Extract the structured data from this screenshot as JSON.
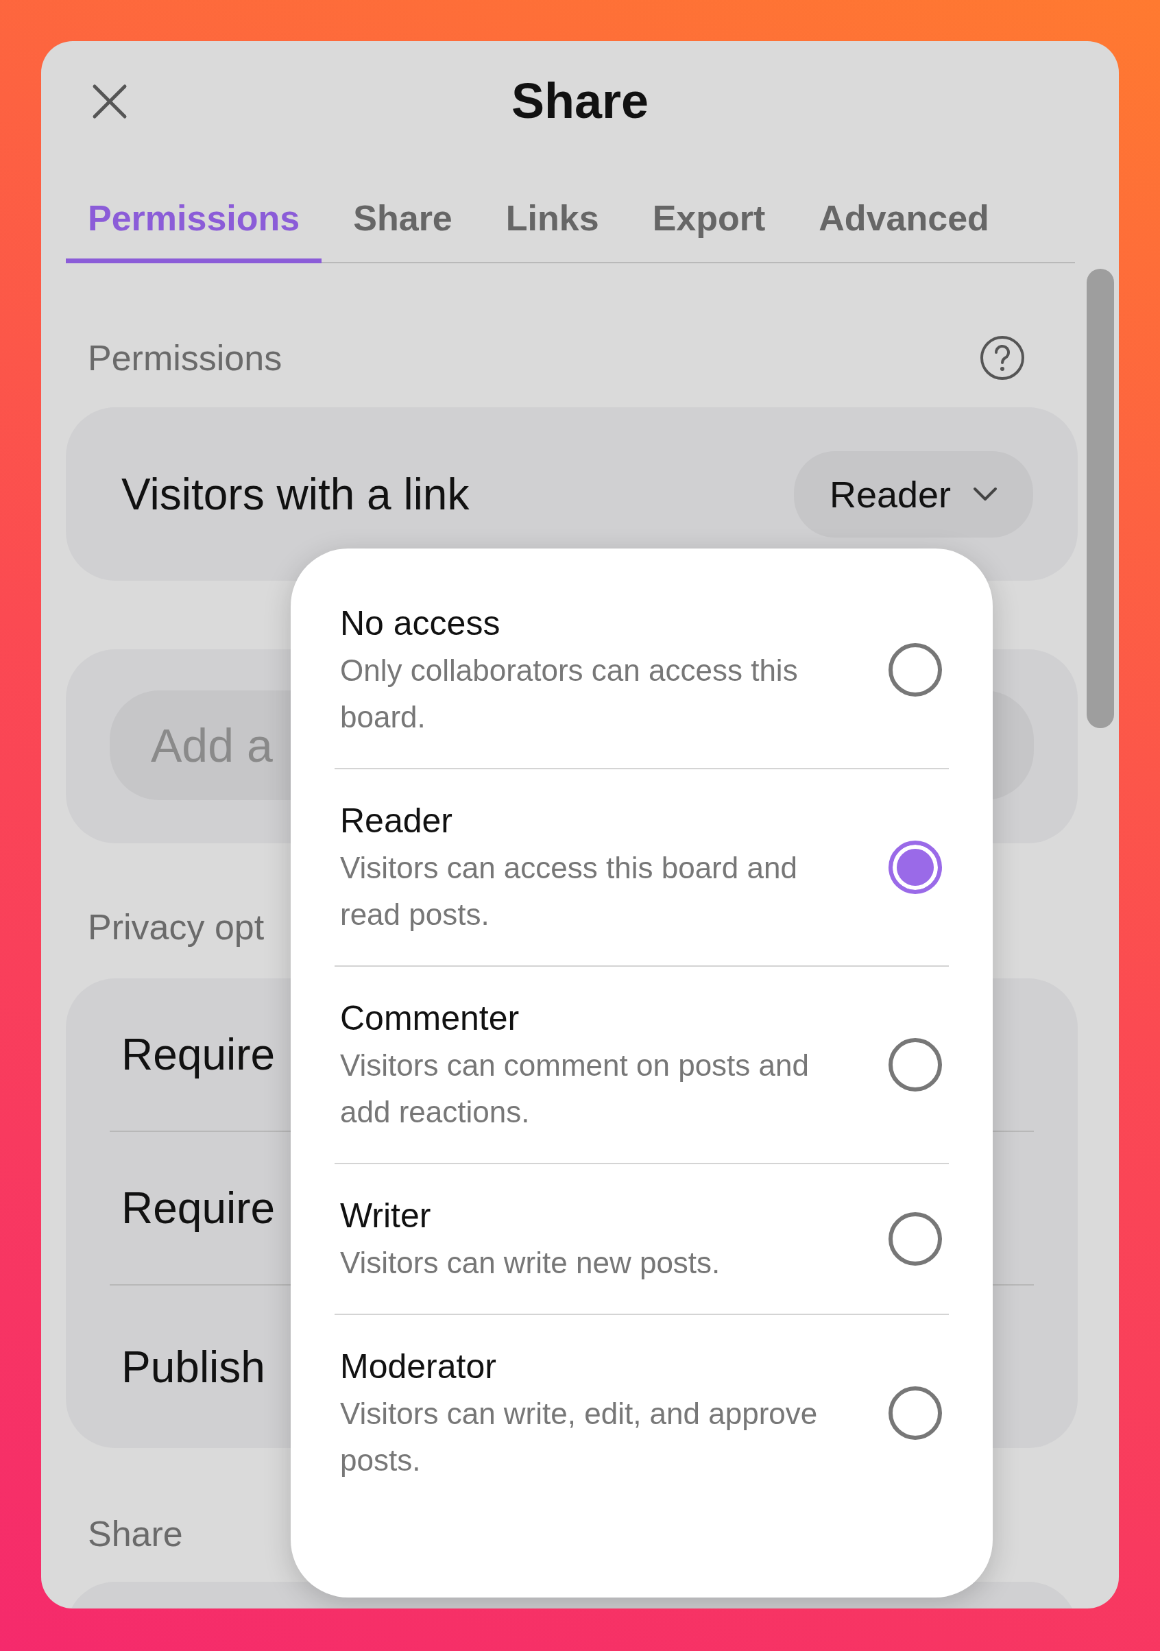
{
  "dialog": {
    "title": "Share"
  },
  "tabs": [
    {
      "label": "Permissions",
      "selected": true
    },
    {
      "label": "Share",
      "selected": false
    },
    {
      "label": "Links",
      "selected": false
    },
    {
      "label": "Export",
      "selected": false
    },
    {
      "label": "Advanced",
      "selected": false
    }
  ],
  "permissions": {
    "label": "Permissions",
    "visitors": {
      "label": "Visitors with a link",
      "role": "Reader"
    },
    "invite_field": {
      "placeholder": "Add a"
    }
  },
  "privacy": {
    "label": "Privacy opt",
    "rows": [
      "Require",
      "Require",
      "Publish"
    ]
  },
  "share": {
    "label": "Share"
  },
  "role_menu": {
    "options": [
      {
        "title": "No access",
        "description": "Only collaborators can access this board.",
        "selected": false
      },
      {
        "title": "Reader",
        "description": "Visitors can access this board and read posts.",
        "selected": true
      },
      {
        "title": "Commenter",
        "description": "Visitors can comment on posts and add reactions.",
        "selected": false
      },
      {
        "title": "Writer",
        "description": "Visitors can write new posts.",
        "selected": false
      },
      {
        "title": "Moderator",
        "description": "Visitors can write, edit, and approve posts.",
        "selected": false
      }
    ]
  }
}
